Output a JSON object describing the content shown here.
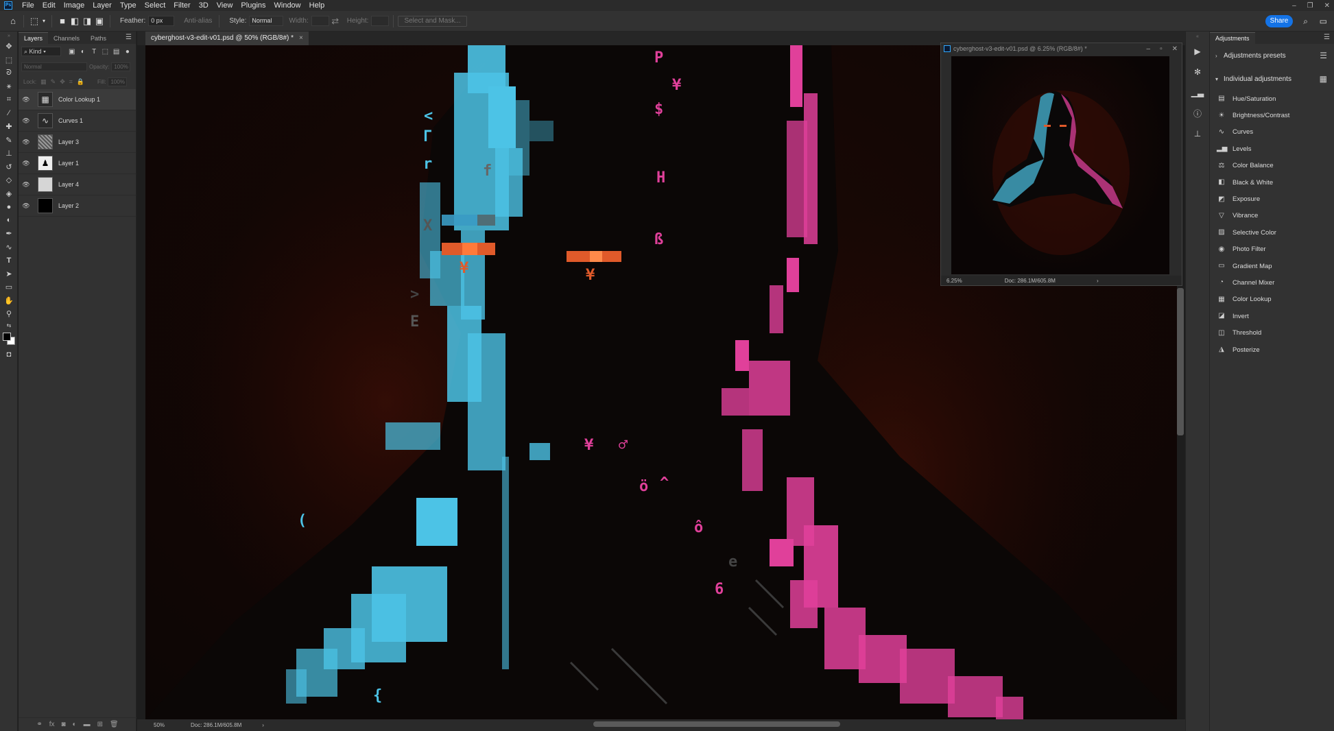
{
  "app": {
    "menu": [
      "File",
      "Edit",
      "Image",
      "Layer",
      "Type",
      "Select",
      "Filter",
      "3D",
      "View",
      "Plugins",
      "Window",
      "Help"
    ],
    "window_controls": [
      "–",
      "❐",
      "✕"
    ]
  },
  "options": {
    "feather_label": "Feather:",
    "feather_value": "0 px",
    "antialias_label": "Anti-alias",
    "style_label": "Style:",
    "style_value": "Normal",
    "width_label": "Width:",
    "height_label": "Height:",
    "select_mask_label": "Select and Mask...",
    "share_label": "Share"
  },
  "layers_panel": {
    "tabs": [
      "Layers",
      "Channels",
      "Paths"
    ],
    "kind_label": "Kind",
    "blend_mode": "Normal",
    "opacity_label": "Opacity:",
    "opacity_value": "100%",
    "lock_label": "Lock:",
    "fill_label": "Fill:",
    "fill_value": "100%",
    "layers": [
      {
        "name": "Color Lookup 1",
        "thumb": "grid"
      },
      {
        "name": "Curves 1",
        "thumb": "curves"
      },
      {
        "name": "Layer 3",
        "thumb": "noise"
      },
      {
        "name": "Layer 1",
        "thumb": "figure"
      },
      {
        "name": "Layer 4",
        "thumb": "pale"
      },
      {
        "name": "Layer 2",
        "thumb": "black"
      }
    ],
    "footer_icons": [
      "link-icon",
      "fx-icon",
      "mask-icon",
      "adjustment-icon",
      "folder-icon",
      "new-layer-icon",
      "trash-icon"
    ]
  },
  "document": {
    "tab_title": "cyberghost-v3-edit-v01.psd @ 50% (RGB/8#) *",
    "zoom": "50%",
    "doc_info": "Doc: 286.1M/605.8M"
  },
  "navigator_window": {
    "title": "cyberghost-v3-edit-v01.psd @ 6.25% (RGB/8#) *",
    "zoom": "6.25%",
    "doc_info": "Doc: 286.1M/605.8M"
  },
  "adjustments_panel": {
    "tab": "Adjustments",
    "presets_label": "Adjustments presets",
    "individual_label": "Individual adjustments",
    "items": [
      {
        "label": "Hue/Saturation",
        "icon": "hue-saturation-icon"
      },
      {
        "label": "Brightness/Contrast",
        "icon": "brightness-icon"
      },
      {
        "label": "Curves",
        "icon": "curves-icon"
      },
      {
        "label": "Levels",
        "icon": "levels-icon"
      },
      {
        "label": "Color Balance",
        "icon": "color-balance-icon"
      },
      {
        "label": "Black & White",
        "icon": "black-white-icon"
      },
      {
        "label": "Exposure",
        "icon": "exposure-icon"
      },
      {
        "label": "Vibrance",
        "icon": "vibrance-icon"
      },
      {
        "label": "Selective Color",
        "icon": "selective-color-icon"
      },
      {
        "label": "Photo Filter",
        "icon": "photo-filter-icon"
      },
      {
        "label": "Gradient Map",
        "icon": "gradient-map-icon"
      },
      {
        "label": "Channel Mixer",
        "icon": "channel-mixer-icon"
      },
      {
        "label": "Color Lookup",
        "icon": "color-lookup-icon"
      },
      {
        "label": "Invert",
        "icon": "invert-icon"
      },
      {
        "label": "Threshold",
        "icon": "threshold-icon"
      },
      {
        "label": "Posterize",
        "icon": "posterize-icon"
      }
    ]
  },
  "artwork_glyphs": {
    "left": [
      "Г",
      "r",
      "<",
      "X",
      "f",
      "E",
      "(",
      "{",
      ">"
    ],
    "right": [
      "P",
      "¥",
      "$",
      "H",
      "ß",
      "¥",
      "♂",
      "ö",
      "ô",
      "^",
      "e",
      "6"
    ],
    "eyes": [
      "¥",
      "¥"
    ]
  },
  "colors": {
    "accent": "#1473e6",
    "cyan": "#4cc3e6",
    "magenta": "#e0409a",
    "eye_orange": "#e05a2a",
    "background_red": "#3a0d06"
  }
}
